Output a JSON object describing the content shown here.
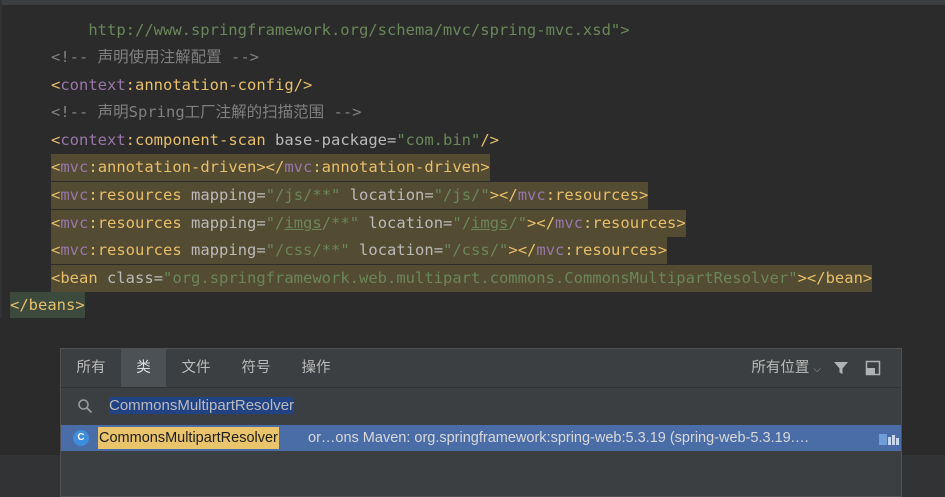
{
  "editor": {
    "lines": {
      "l0": "    http://www.springframework.org/schema/mvc/spring-mvc.xsd\">",
      "l1": "<!-- 声明使用注解配置 -->",
      "l2_ns": "context",
      "l2_name": "annotation-config",
      "l3": "<!-- 声明Spring工厂注解的扫描范围 -->",
      "l4_ns": "context",
      "l4_name": "component-scan",
      "l4_attr": "base-package",
      "l4_val": "\"com.bin\"",
      "l5_ns": "mvc",
      "l5_name": "annotation-driven",
      "l6_attr1": "mapping",
      "l6_val1": "\"/js/**\"",
      "l6_attr2": "location",
      "l6_val2": "\"/js/\"",
      "l7_val1a": "\"/",
      "l7_val1b": "imgs",
      "l7_val1c": "/**\"",
      "l7_val2a": "\"/",
      "l7_val2b": "imgs",
      "l7_val2c": "/\"",
      "l8_val1": "\"/css/**\"",
      "l8_val2": "\"/css/\"",
      "res_name": "resources",
      "l9_tag": "bean",
      "l9_attr": "class",
      "l9_val": "\"org.springframework.web.multipart.commons.CommonsMultipartResolver\"",
      "l10_tag": "beans"
    }
  },
  "popup": {
    "tabs": [
      "所有",
      "类",
      "文件",
      "符号",
      "操作"
    ],
    "scope_label": "所有位置",
    "search_value": "CommonsMultipartResolver",
    "result": {
      "icon_letter": "C",
      "name": "CommonsMultipartResolver",
      "rest": " or…ons  Maven: org.springframework:spring-web:5.3.19 (spring-web-5.3.19.…"
    }
  },
  "colors": {
    "tag": "#e8bf6a",
    "namespace": "#9876aa",
    "string": "#6a8759",
    "comment": "#808080",
    "selection": "#4a6da7",
    "highlight": "#534b32"
  }
}
